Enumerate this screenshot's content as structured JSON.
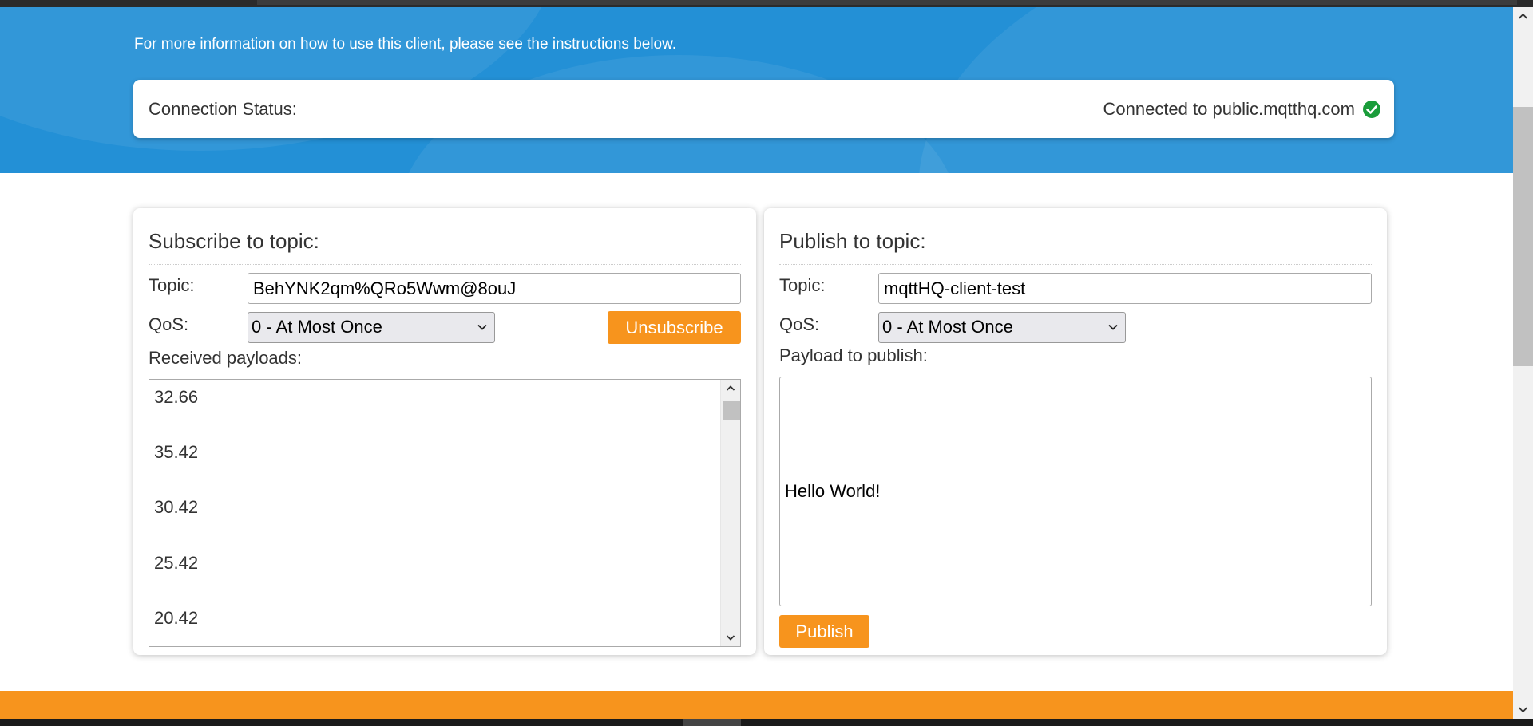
{
  "header": {
    "intro": "For more information on how to use this client, please see the instructions below."
  },
  "status": {
    "label": "Connection Status:",
    "value": "Connected to public.mqtthq.com",
    "icon": "check-circle-icon",
    "color": "#1a9c3a"
  },
  "subscribe": {
    "title": "Subscribe to topic:",
    "topic_label": "Topic:",
    "topic_value": "BehYNK2qm%QRo5Wwm@8ouJ",
    "qos_label": "QoS:",
    "qos_selected": "0 - At Most Once",
    "unsubscribe_label": "Unsubscribe",
    "received_label": "Received payloads:",
    "payloads": [
      "32.66",
      "35.42",
      "30.42",
      "25.42",
      "20.42"
    ]
  },
  "publish": {
    "title": "Publish to topic:",
    "topic_label": "Topic:",
    "topic_value": "mqttHQ-client-test",
    "qos_label": "QoS:",
    "qos_selected": "0 - At Most Once",
    "payload_label": "Payload to publish:",
    "payload_value": "Hello World!",
    "publish_label": "Publish"
  },
  "colors": {
    "brand_blue": "#2390d6",
    "accent_orange": "#f7941d"
  }
}
